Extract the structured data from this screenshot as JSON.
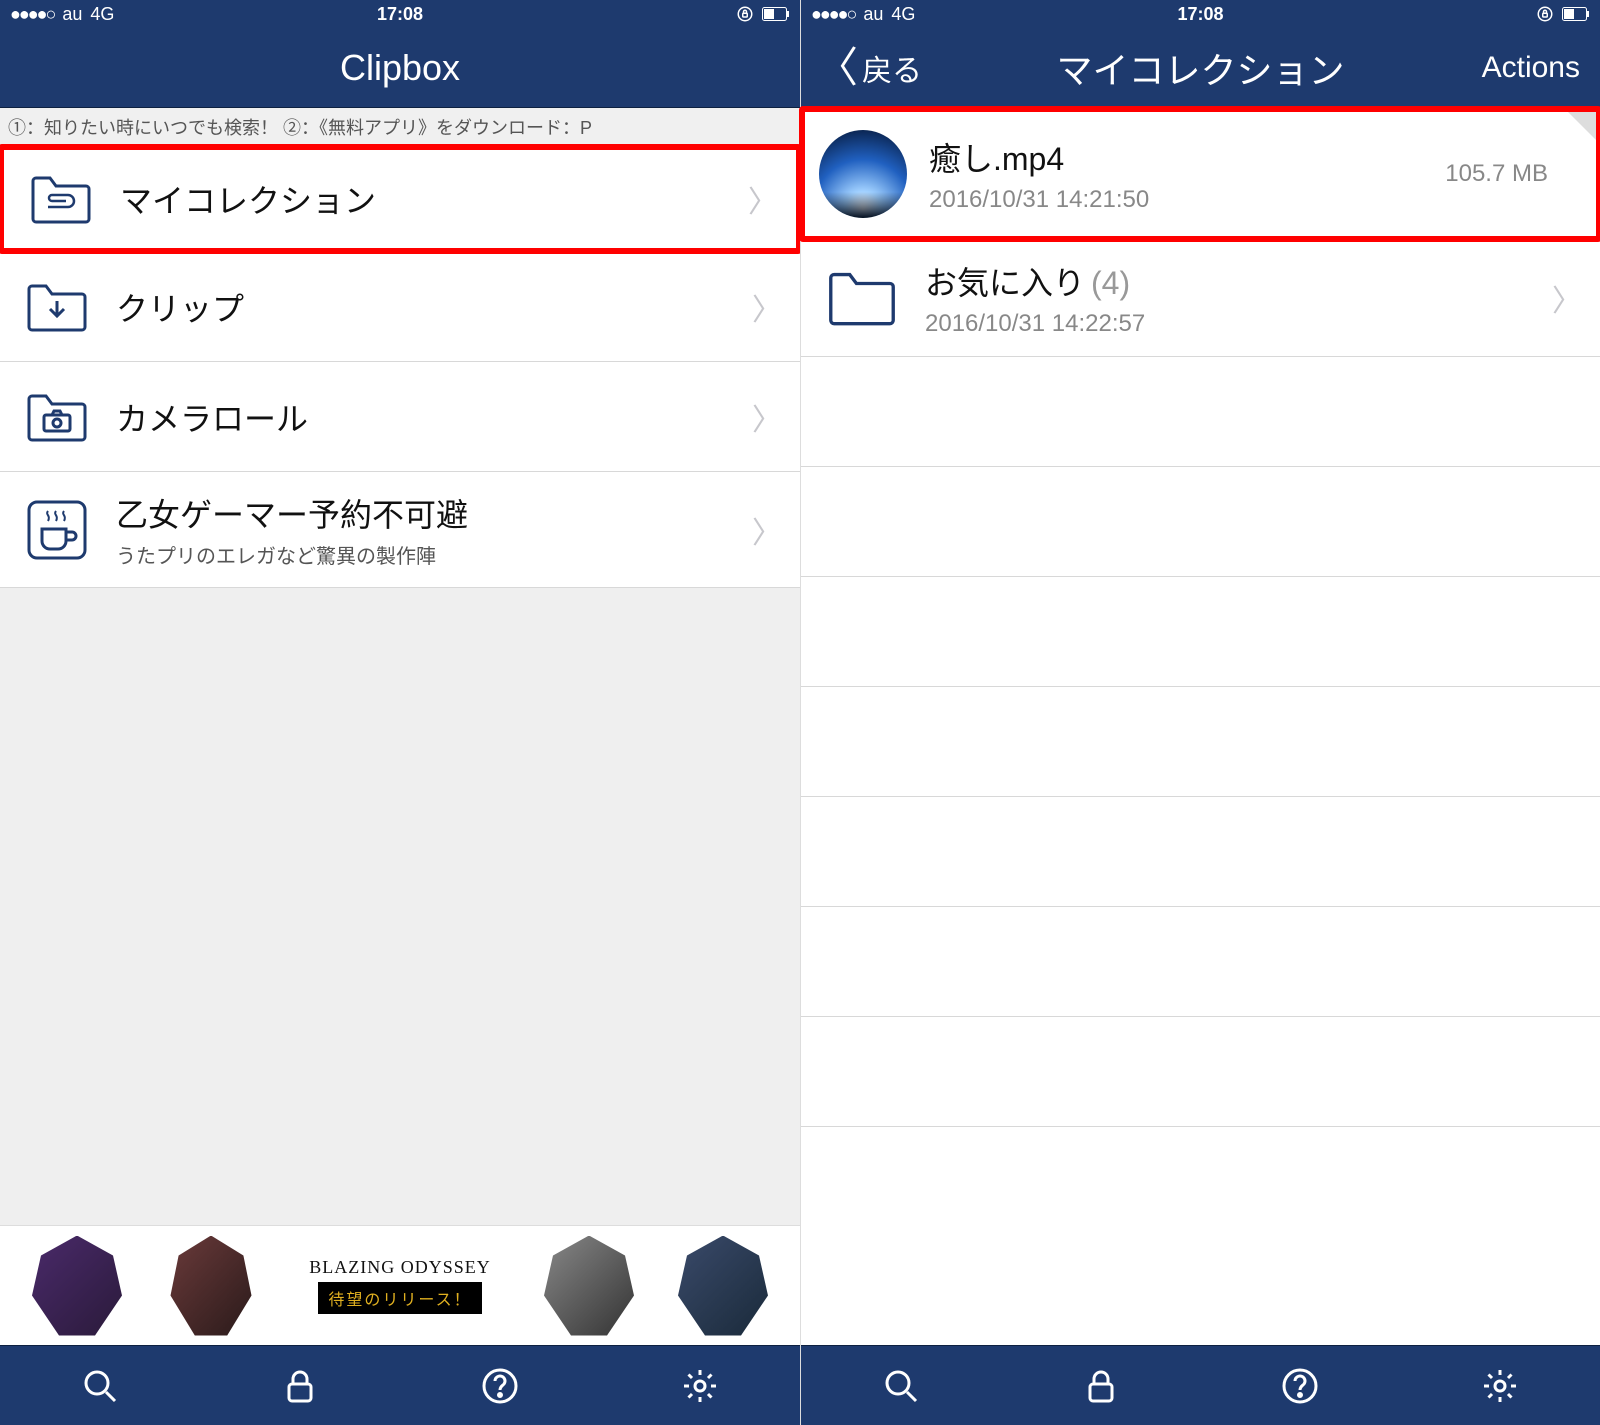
{
  "status": {
    "signal": "●●●●○",
    "carrier": "au",
    "network": "4G",
    "time": "17:08",
    "lock_icon": "lock-rotation",
    "battery_icon": "battery"
  },
  "left": {
    "nav": {
      "title": "Clipbox"
    },
    "ad_text": "①：知りたい時にいつでも検索！ ②：《無料アプリ》をダウンロード：P",
    "rows": [
      {
        "icon": "folder-clip",
        "title": "マイコレクション",
        "highlight": true
      },
      {
        "icon": "folder-download",
        "title": "クリップ"
      },
      {
        "icon": "folder-camera",
        "title": "カメラロール"
      },
      {
        "icon": "coffee",
        "title": "乙女ゲーマー予約不可避",
        "subtitle": "うたプリのエレガなど驚異の製作陣"
      }
    ],
    "bottom_ad": {
      "title": "BLAZING ODYSSEY",
      "tag": "待望のリリース！"
    }
  },
  "right": {
    "nav": {
      "back": "戻る",
      "title": "マイコレクション",
      "actions": "Actions"
    },
    "items": [
      {
        "type": "file",
        "name": "癒し.mp4",
        "date": "2016/10/31 14:21:50",
        "size": "105.7 MB",
        "highlight": true
      },
      {
        "type": "folder",
        "name": "お気に入り",
        "count": "(4)",
        "date": "2016/10/31 14:22:57"
      }
    ]
  },
  "tabs": [
    "search",
    "lock",
    "help",
    "settings"
  ]
}
